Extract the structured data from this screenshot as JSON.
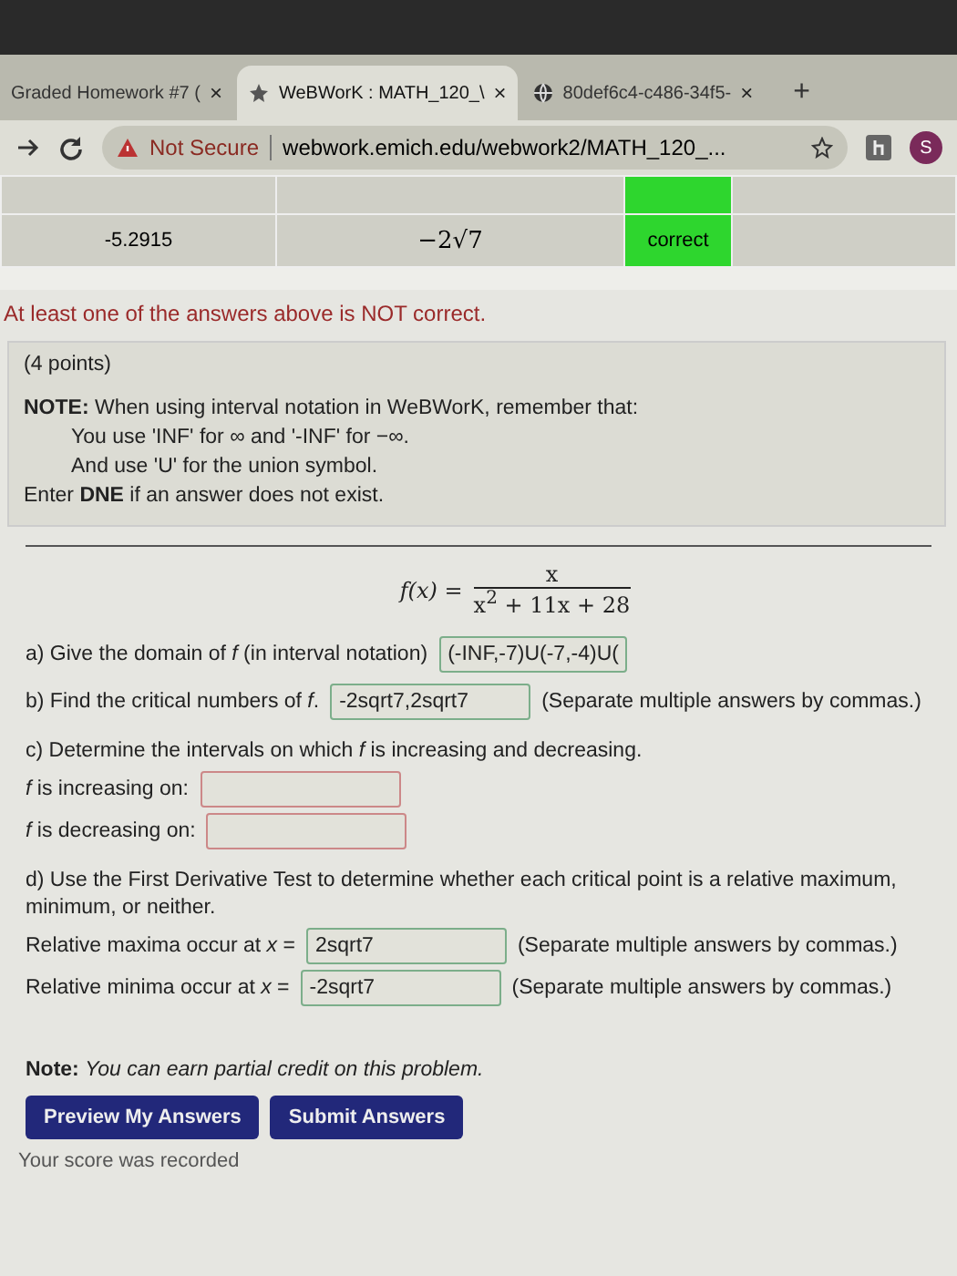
{
  "browser": {
    "tabs": [
      {
        "label": "Graded Homework #7 (",
        "selected": false,
        "kind": "doc",
        "close": "×"
      },
      {
        "label": "WeBWorK : MATH_120_\\",
        "selected": true,
        "kind": "star",
        "close": "×"
      },
      {
        "label": "80def6c4-c486-34f5-",
        "selected": false,
        "kind": "globe",
        "close": "×"
      }
    ],
    "new_tab": "+",
    "security": "Not Secure",
    "url": "webwork.emich.edu/webwork2/MATH_120_...",
    "profile": "S"
  },
  "results_table": {
    "rows": [
      {
        "correct": true
      },
      {
        "entered": "-5.2915",
        "preview": "−2√7",
        "result": "correct",
        "correct": true
      }
    ]
  },
  "message": "At least one of the answers above is NOT correct.",
  "problem": {
    "points": "(4 points)",
    "note": [
      "**NOTE:** When using interval notation in WeBWorK, remember that:",
      "You use 'INF' for ∞ and '-INF' for −∞.",
      "And use 'U' for the union symbol.",
      "Enter **DNE** if an answer does not exist."
    ],
    "formula": {
      "lhs": "f(x) =",
      "numerator": "x",
      "denominator": "x$^{2}$ + 11x + 28"
    },
    "parts": [
      {
        "kind": "row",
        "label": "a) Give the domain of *f* (in interval notation)",
        "value": "(-INF,-7)U(-7,-4)U(",
        "correct": true
      },
      {
        "kind": "row",
        "label": "b) Find the critical numbers of *f*.",
        "value": "-2sqrt7,2sqrt7",
        "correct": true,
        "hint": "(Separate multiple answers by commas.)"
      },
      {
        "kind": "text",
        "label": "c) Determine the intervals on which *f* is increasing and decreasing."
      },
      {
        "kind": "line",
        "label": "*f* is increasing on:",
        "correct": false
      },
      {
        "kind": "line",
        "label": "*f* is decreasing on:",
        "correct": false
      },
      {
        "kind": "text",
        "label": "d) Use the First Derivative Test to determine whether each critical point is a relative maximum, minimum, or neither."
      },
      {
        "kind": "line",
        "label": "Relative maxima occur at *x* =",
        "value": "2sqrt7",
        "correct": true,
        "hint": "(Separate multiple answers by commas.)"
      },
      {
        "kind": "line",
        "label": "Relative minima occur at *x* =",
        "value": "-2sqrt7",
        "correct": true,
        "hint": "(Separate multiple answers by commas.)"
      }
    ],
    "credit_note": "**Note:** *You can earn partial credit on this problem.*",
    "buttons": [
      "Preview My Answers",
      "Submit Answers"
    ]
  },
  "footer": "Your score was recorded"
}
